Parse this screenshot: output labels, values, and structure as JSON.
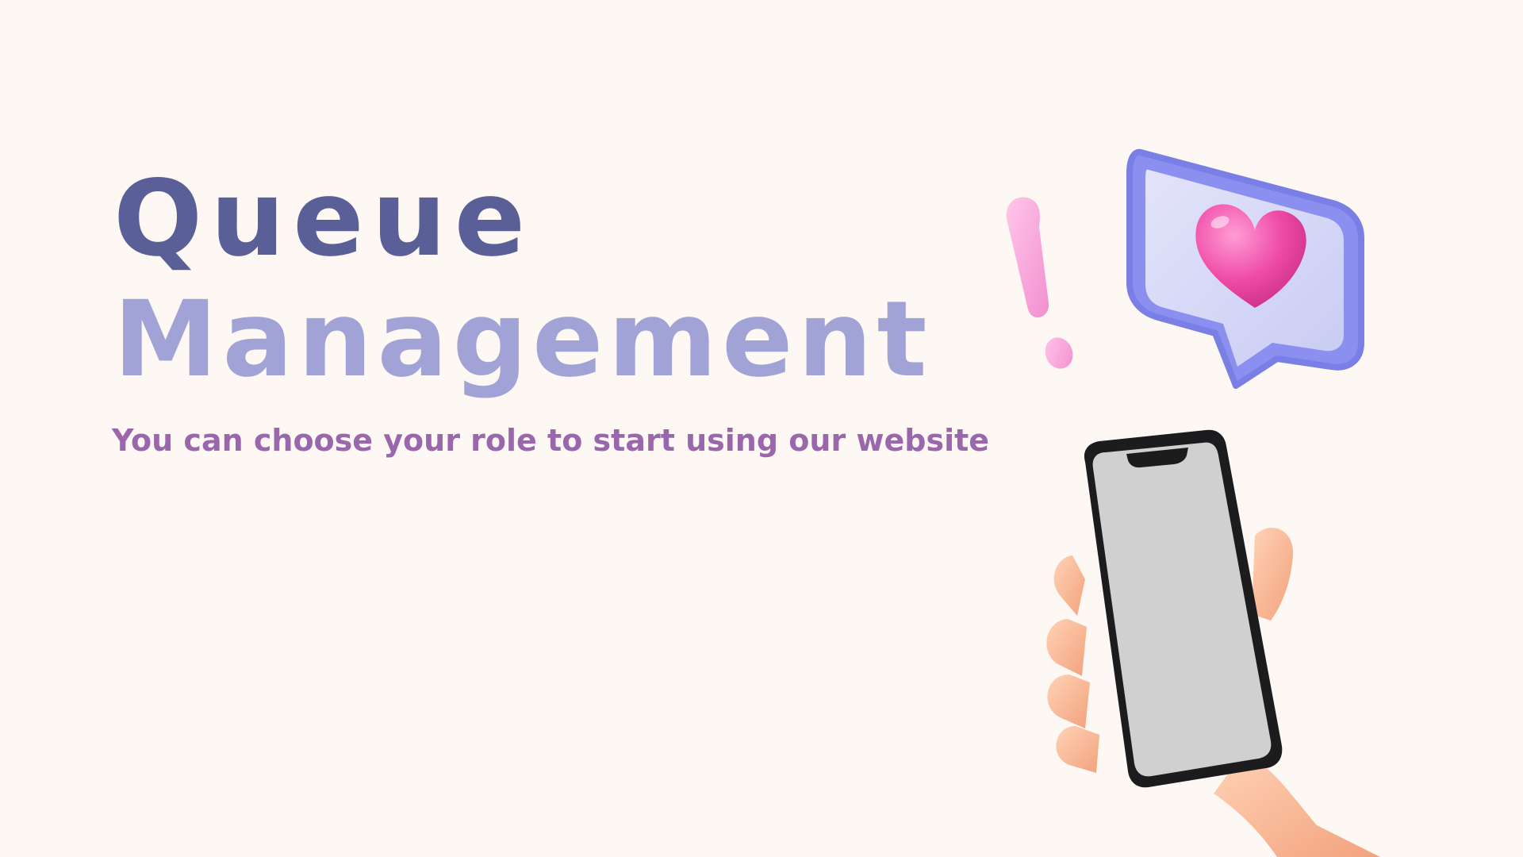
{
  "hero": {
    "title_line_1": "Queue",
    "title_line_2": "Management",
    "subtitle": "You can choose your role to start using our website"
  },
  "colors": {
    "background": "#fdf8f3",
    "title_primary": "#5a6097",
    "title_secondary": "#a1a3d6",
    "subtitle": "#9b67ac",
    "accent_pink": "#ee4aa6",
    "bubble_blue": "#7f86e8"
  },
  "illustration": {
    "icons": [
      "exclamation-icon",
      "heart-icon",
      "speech-bubble-icon",
      "hand-holding-phone-icon"
    ]
  }
}
